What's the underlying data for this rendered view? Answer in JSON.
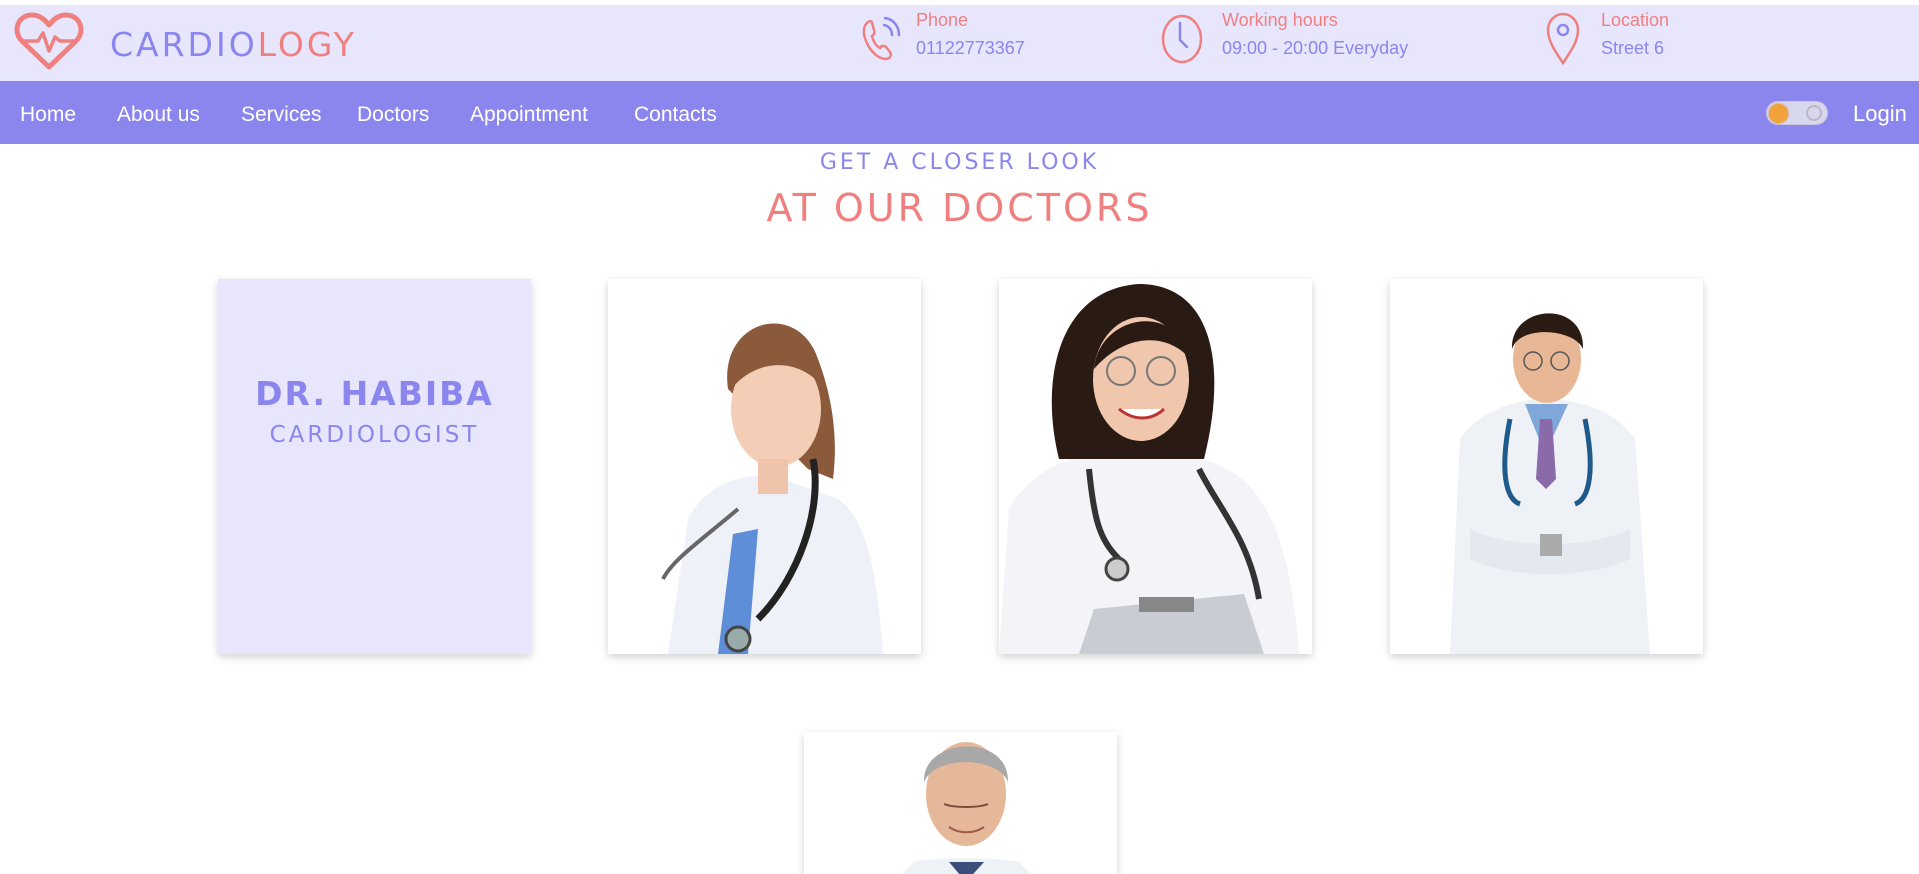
{
  "brand": {
    "part1": "CARDIO",
    "part2": "LOGY"
  },
  "contact": {
    "phone": {
      "label": "Phone",
      "value": "01122773367",
      "icon": "phone-icon"
    },
    "hours": {
      "label": "Working hours",
      "value": "09:00 - 20:00 Everyday",
      "icon": "clock-icon"
    },
    "location": {
      "label": "Location",
      "value": "Street 6",
      "icon": "location-pin-icon"
    }
  },
  "nav": {
    "items": [
      {
        "label": "Home"
      },
      {
        "label": "About us"
      },
      {
        "label": "Services"
      },
      {
        "label": "Doctors"
      },
      {
        "label": "Appointment"
      },
      {
        "label": "Contacts"
      }
    ],
    "login": "Login"
  },
  "section": {
    "subtitle": "GET A CLOSER LOOK",
    "title": "AT OUR DOCTORS"
  },
  "doctors": {
    "featured": {
      "name": "DR. HABIBA",
      "role": "CARDIOLOGIST"
    }
  },
  "colors": {
    "primary": "#8b86ee",
    "accent": "#f07f7f",
    "light_bg": "#e7e6fd"
  }
}
